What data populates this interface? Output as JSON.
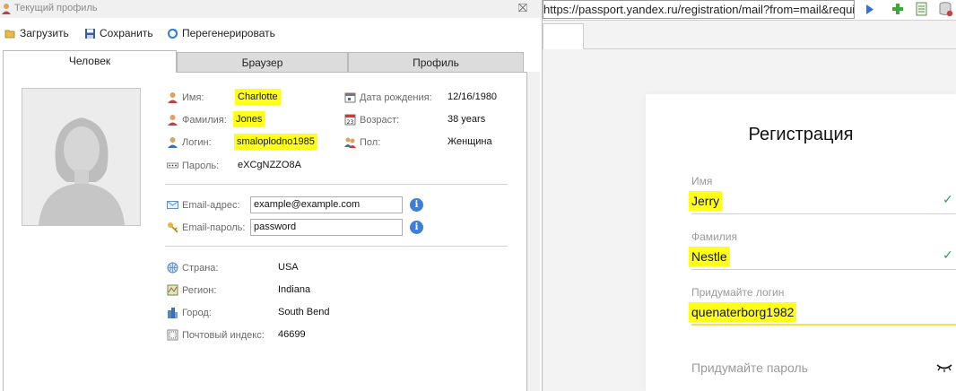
{
  "left_window": {
    "title": "Текущий профиль",
    "close_glyph": "⛝",
    "toolbar": {
      "load": "Загрузить",
      "save": "Сохранить",
      "regenerate": "Перегенерировать"
    },
    "tabs": [
      "Человек",
      "Браузер",
      "Профиль"
    ],
    "person": {
      "first_name_label": "Имя:",
      "first_name": "Charlotte",
      "last_name_label": "Фамилия:",
      "last_name": "Jones",
      "login_label": "Логин:",
      "login": "smaloplodno1985",
      "password_label": "Пароль:",
      "password": "eXCgNZZO8A",
      "dob_label": "Дата рождения:",
      "dob": "12/16/1980",
      "age_label": "Возраст:",
      "age": "38 years",
      "sex_label": "Пол:",
      "sex": "Женщина"
    },
    "email": {
      "address_label": "Email-адрес:",
      "address": "example@example.com",
      "password_label": "Email-пароль:",
      "password": "password",
      "info_glyph": "i"
    },
    "location": {
      "country_label": "Страна:",
      "country": "USA",
      "region_label": "Регион:",
      "region": "Indiana",
      "city_label": "Город:",
      "city": "South Bend",
      "zip_label": "Почтовый индекс:",
      "zip": "46699"
    }
  },
  "browser": {
    "url": "https://passport.yandex.ru/registration/mail?from=mail&require",
    "registration": {
      "title": "Регистрация",
      "first_name_label": "Имя",
      "first_name": "Jerry",
      "last_name_label": "Фамилия",
      "last_name": "Nestle",
      "login_label": "Придумайте логин",
      "login": "quenaterborg1982",
      "password_placeholder": "Придумайте пароль",
      "check_glyph": "✓"
    }
  },
  "colors": {
    "highlight": "#ffff1a",
    "info_blue": "#3d7fd6",
    "check_green": "#2aa848",
    "focus_yellow": "#ffdb4d"
  }
}
